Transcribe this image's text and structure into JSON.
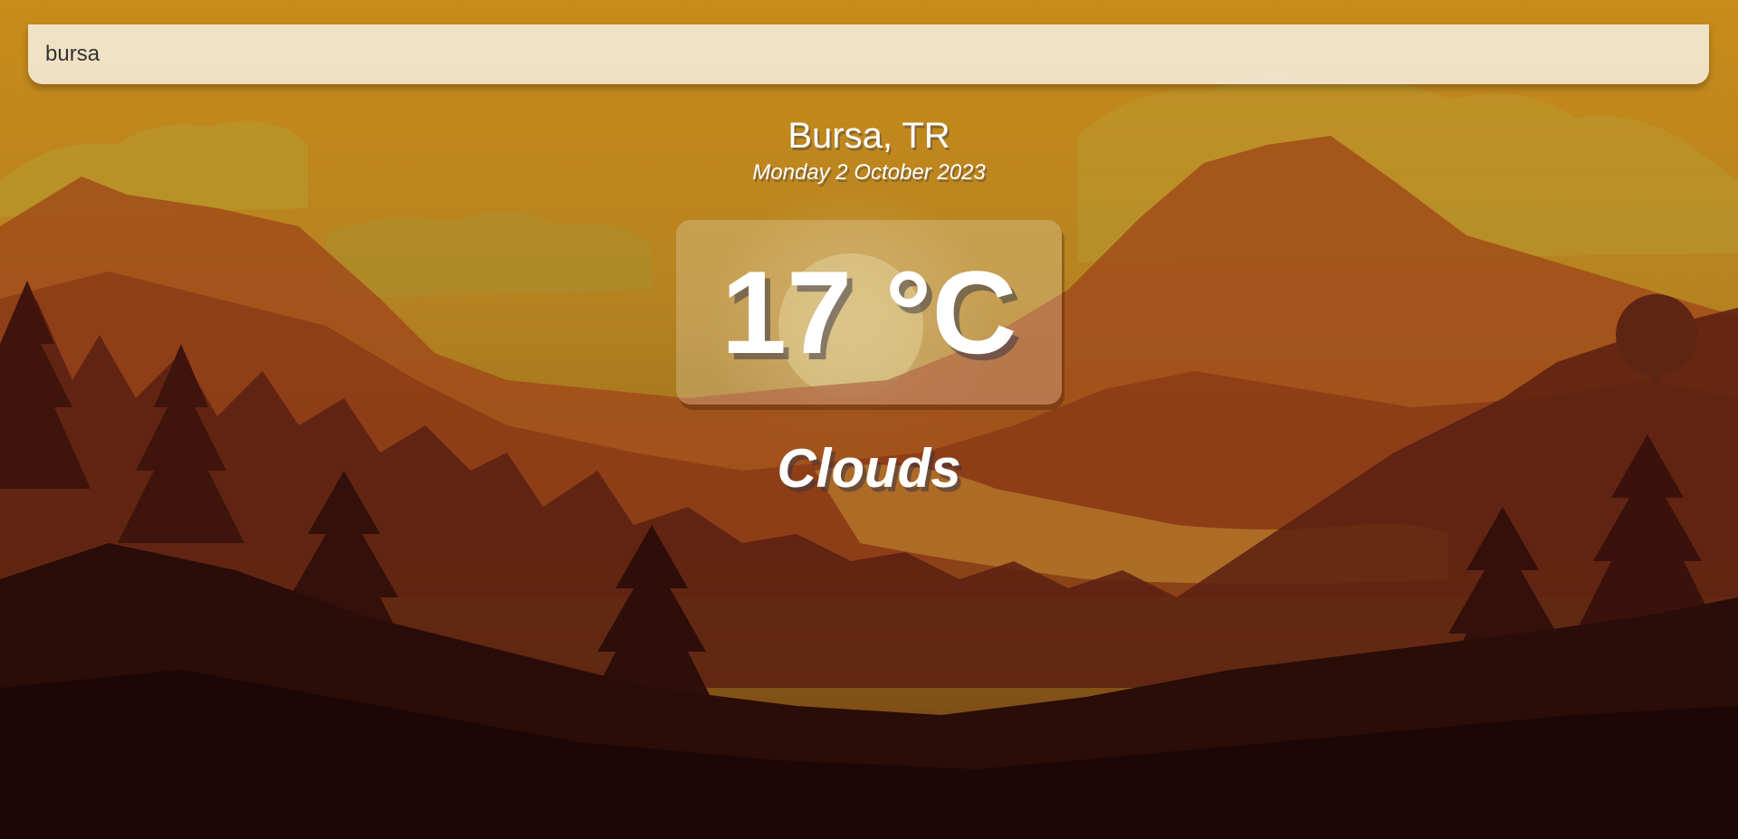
{
  "search": {
    "value": "bursa",
    "placeholder": ""
  },
  "location": {
    "city_country": "Bursa, TR",
    "date": "Monday 2 October 2023"
  },
  "weather": {
    "temperature": "17 °C",
    "condition": "Clouds"
  },
  "colors": {
    "sky_top": "#c98b1a",
    "sky_mid": "#b07a20",
    "mountain": "#a84e1c",
    "forest_dark": "#1c0706",
    "text": "#ffffff"
  }
}
